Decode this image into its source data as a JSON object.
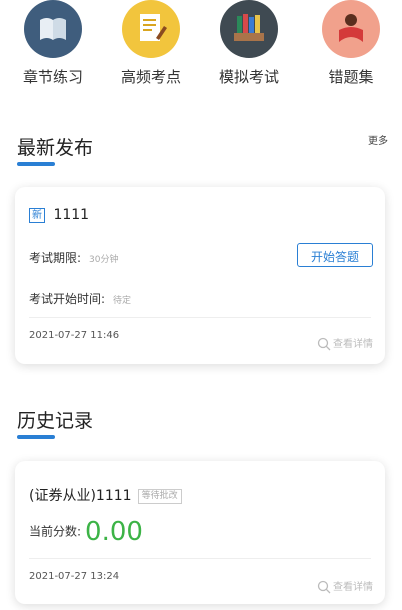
{
  "nav": {
    "items": [
      {
        "label": "章节练习",
        "icon": "book-icon",
        "color": "#3f5d7d"
      },
      {
        "label": "高频考点",
        "icon": "notepad-icon",
        "color": "#f2c53d"
      },
      {
        "label": "模拟考试",
        "icon": "books-stack-icon",
        "color": "#3f4a52"
      },
      {
        "label": "错题集",
        "icon": "reader-icon",
        "color": "#f1a18c"
      }
    ]
  },
  "latest": {
    "title": "最新发布",
    "more_label": "更多",
    "card": {
      "badge": "新",
      "name": "1111",
      "limit_label": "考试期限:",
      "limit_value": "30分钟",
      "start_button": "开始答题",
      "start_time_label": "考试开始时间:",
      "start_time_value": "待定",
      "date": "2021-07-27 11:46",
      "detail_label": "查看详情"
    }
  },
  "history": {
    "title": "历史记录",
    "card": {
      "name": "(证券从业)1111",
      "status": "等待批改",
      "score_label": "当前分数:",
      "score_value": "0.00",
      "date": "2021-07-27 13:24",
      "detail_label": "查看详情"
    }
  },
  "colors": {
    "accent": "#2a7fd4",
    "score": "#3cb346"
  }
}
